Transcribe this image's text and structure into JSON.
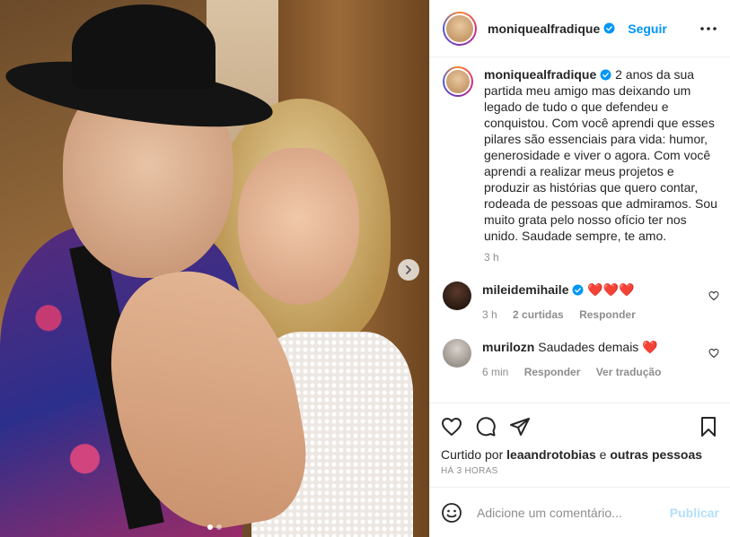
{
  "post": {
    "username": "moniquealfradique",
    "follow_label": "Seguir",
    "caption": "2 anos da sua partida meu amigo mas deixando um legado de tudo o que defendeu e conquistou. Com você aprendi que esses pilares são essenciais para vida: humor, generosidade e viver o agora. Com você aprendi a realizar meus projetos e produzir as histórias que quero contar, rodeada de pessoas que admiramos. Sou muito grata pelo nosso ofício ter nos unido. Saudade sempre, te amo.",
    "caption_time": "3 h"
  },
  "comments": [
    {
      "username": "mileidemihaile",
      "text": "❤️❤️❤️",
      "time": "3 h",
      "likes": "2 curtidas",
      "reply": "Responder"
    },
    {
      "username": "murilozn",
      "text": "Saudades demais ❤️",
      "time": "6 min",
      "reply": "Responder",
      "translate": "Ver tradução"
    }
  ],
  "likes": {
    "prefix": "Curtido por",
    "user": "leaandrotobias",
    "connector": "e",
    "others": "outras pessoas"
  },
  "timestamp": "HÁ 3 HORAS",
  "add_comment": {
    "placeholder": "Adicione um comentário...",
    "publish_label": "Publicar"
  },
  "icons": {
    "verified": "verified-badge-icon",
    "more": "more-options-icon",
    "like": "heart-icon",
    "comment": "comment-icon",
    "share": "share-icon",
    "save": "bookmark-icon",
    "emoji": "emoji-icon",
    "next": "chevron-right-icon"
  },
  "colors": {
    "link_blue": "#0095f6",
    "publish_disabled": "#b2dffc",
    "muted": "#8e8e8e",
    "heart_red": "#ed4956"
  }
}
